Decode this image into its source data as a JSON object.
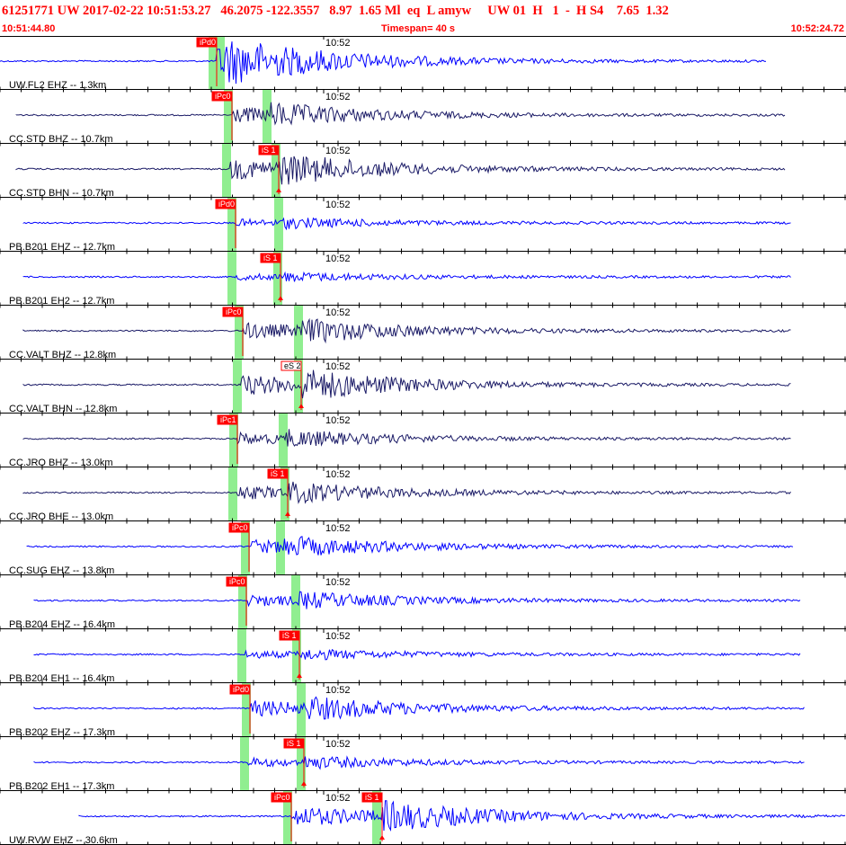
{
  "header": {
    "title": "61251771 UW 2017-02-22 10:51:53.27   46.2075 -122.3557   8.97  1.65 Ml  eq  L amyw     UW 01  H   1  -  H S4    7.65  1.32",
    "start_time": "10:51:44.80",
    "timespan": "Timespan=  40 s",
    "end_time": "10:52:24.72"
  },
  "colors": {
    "header_red": "#ff0000",
    "pick_red": "#ff0000",
    "window_green": "#90ee90",
    "trace_blue": "#0000ff",
    "trace_navy": "#1a1a66"
  },
  "traces": [
    {
      "label": "UW.FL2 EHZ -- 1.3km",
      "time_mark": "10:52",
      "color": "blue",
      "picks": [
        {
          "text": "iPd0",
          "type": "P"
        }
      ]
    },
    {
      "label": "CC.STD BHZ -- 10.7km",
      "time_mark": "10:52",
      "color": "navy",
      "picks": [
        {
          "text": "iPc0",
          "type": "P"
        }
      ]
    },
    {
      "label": "CC.STD BHN -- 10.7km",
      "time_mark": "10:52",
      "color": "navy",
      "picks": [
        {
          "text": "iS 1",
          "type": "S"
        }
      ]
    },
    {
      "label": "PB.B201 EHZ -- 12.7km",
      "time_mark": "10:52",
      "color": "blue",
      "picks": [
        {
          "text": "iPd0",
          "type": "P"
        }
      ]
    },
    {
      "label": "PB.B201 EH2 -- 12.7km",
      "time_mark": "10:52",
      "color": "blue",
      "picks": [
        {
          "text": "iS 1",
          "type": "S"
        }
      ]
    },
    {
      "label": "CC.VALT BHZ -- 12.8km",
      "time_mark": "10:52",
      "color": "navy",
      "picks": [
        {
          "text": "iPc0",
          "type": "P"
        }
      ]
    },
    {
      "label": "CC.VALT BHN -- 12.8km",
      "time_mark": "10:52",
      "color": "navy",
      "picks": [
        {
          "text": "eS 2",
          "type": "S"
        }
      ]
    },
    {
      "label": "CC.JRO BHZ -- 13.0km",
      "time_mark": "10:52",
      "color": "navy",
      "picks": [
        {
          "text": "iPc1",
          "type": "P"
        }
      ]
    },
    {
      "label": "CC.JRO BHE -- 13.0km",
      "time_mark": "10:52",
      "color": "navy",
      "picks": [
        {
          "text": "iS 1",
          "type": "S"
        }
      ]
    },
    {
      "label": "CC.SUG EHZ -- 13.8km",
      "time_mark": "10:52",
      "color": "blue",
      "picks": [
        {
          "text": "iPc0",
          "type": "P"
        }
      ]
    },
    {
      "label": "PB.B204 EHZ -- 16.4km",
      "time_mark": "10:52",
      "color": "blue",
      "picks": [
        {
          "text": "iPc0",
          "type": "P"
        }
      ]
    },
    {
      "label": "PB.B204 EH1 -- 16.4km",
      "time_mark": "10:52",
      "color": "blue",
      "picks": [
        {
          "text": "iS 1",
          "type": "S"
        }
      ]
    },
    {
      "label": "PB.B202 EHZ -- 17.3km",
      "time_mark": "10:52",
      "color": "blue",
      "picks": [
        {
          "text": "iPd0",
          "type": "P"
        }
      ]
    },
    {
      "label": "PB.B202 EH1 -- 17.3km",
      "time_mark": "10:52",
      "color": "blue",
      "picks": [
        {
          "text": "iS 1",
          "type": "S"
        }
      ]
    },
    {
      "label": "UW.RVW EHZ -- 30.6km",
      "time_mark": "10:52",
      "color": "blue",
      "picks": [
        {
          "text": "iPc0",
          "type": "P"
        },
        {
          "text": "iS 1",
          "type": "S"
        }
      ]
    }
  ]
}
